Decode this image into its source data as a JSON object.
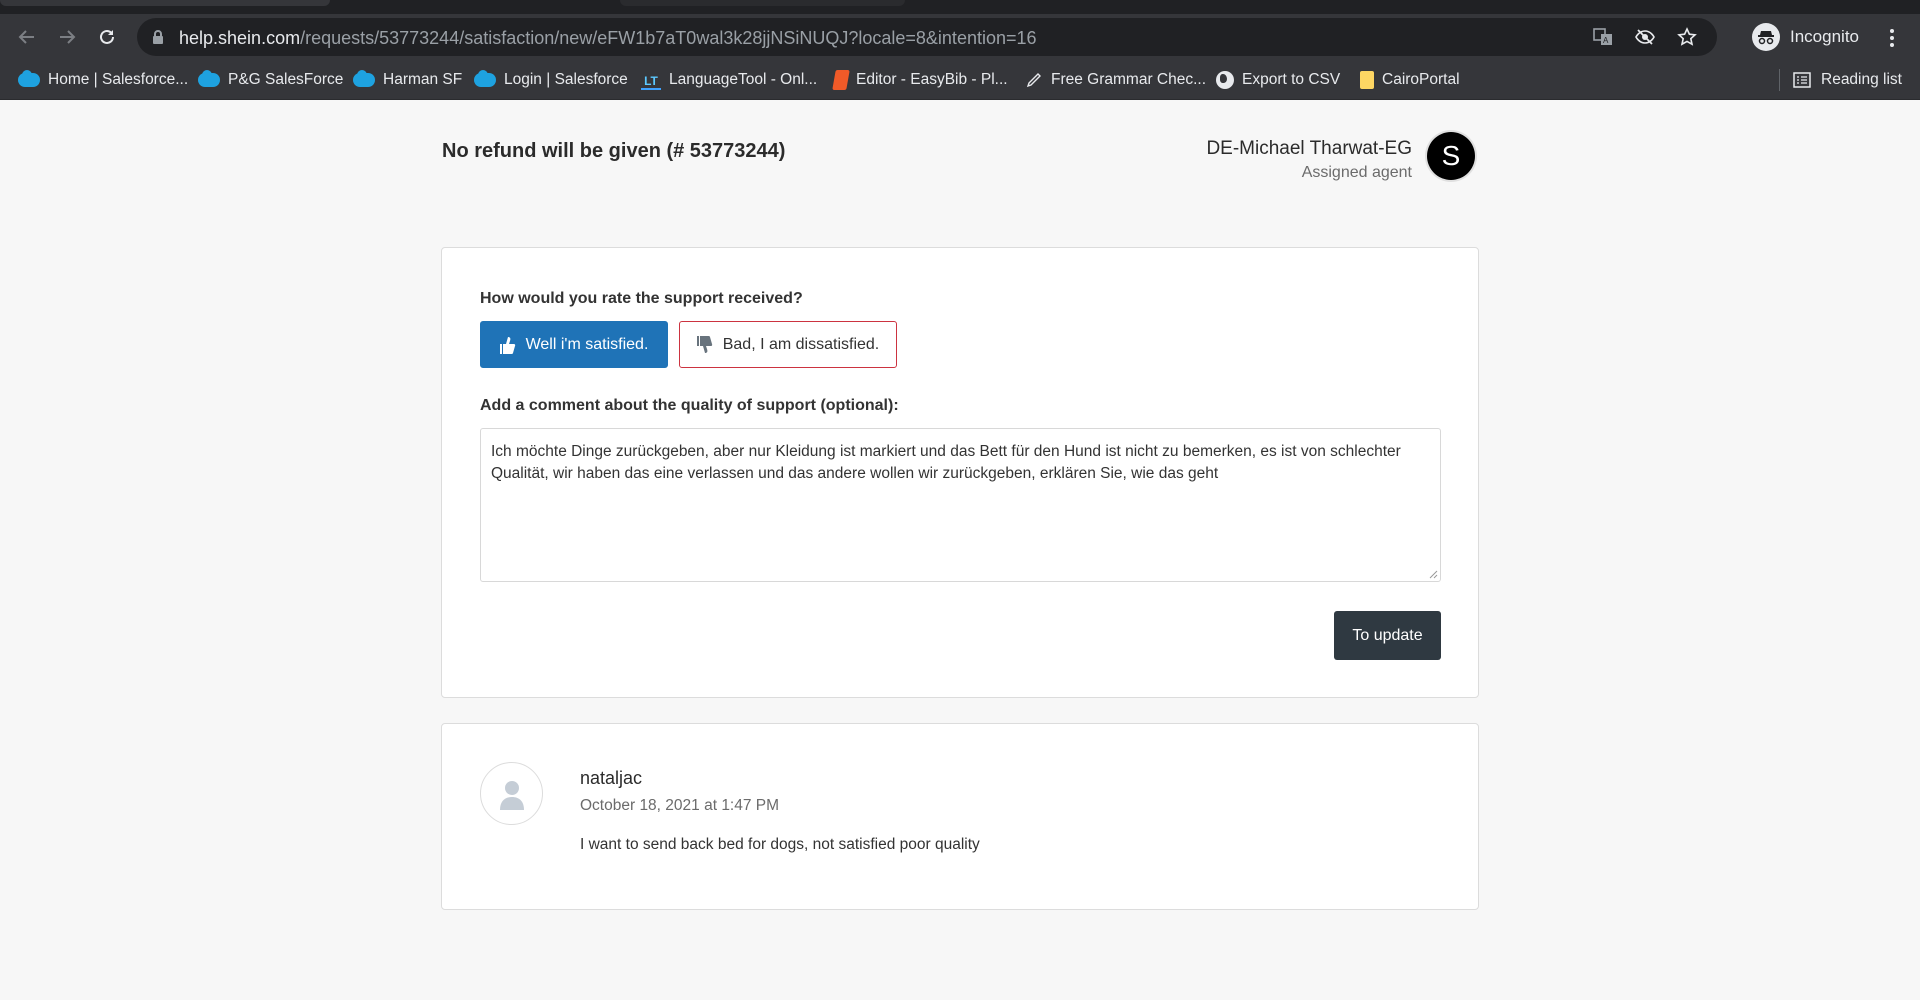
{
  "browser": {
    "url_host": "help.shein.com",
    "url_path": "/requests/53773244/satisfaction/new/eFW1b7aT0wal3k28jjNSiNUQJ?locale=8&intention=16",
    "profile_label": "Incognito",
    "icons": [
      "back-icon",
      "forward-icon",
      "reload-icon",
      "lock-icon",
      "translate-icon",
      "eye-off-icon",
      "star-icon",
      "incognito-icon",
      "menu-icon"
    ]
  },
  "bookmarks": [
    {
      "label": "Home | Salesforce...",
      "icon": "salesforce-icon"
    },
    {
      "label": "P&G SalesForce",
      "icon": "salesforce-icon"
    },
    {
      "label": "Harman SF",
      "icon": "salesforce-icon"
    },
    {
      "label": "Login | Salesforce",
      "icon": "salesforce-icon"
    },
    {
      "label": "LanguageTool - Onl...",
      "icon": "languagetool-icon"
    },
    {
      "label": "Editor - EasyBib - Pl...",
      "icon": "easybib-icon"
    },
    {
      "label": "Free Grammar Chec...",
      "icon": "pen-icon"
    },
    {
      "label": "Export to CSV",
      "icon": "globe-icon"
    },
    {
      "label": "CairoPortal",
      "icon": "folder-icon"
    }
  ],
  "reading_list": "Reading list",
  "request": {
    "title": "No refund will be given (# 53773244)",
    "agent_name": "DE-Michael Tharwat-EG",
    "agent_role": "Assigned agent",
    "agent_initial": "S"
  },
  "rating": {
    "question": "How would you rate the support received?",
    "good_label": "Well i'm satisfied.",
    "bad_label": "Bad, I am dissatisfied.",
    "selected": "good",
    "comment_label": "Add a comment about the quality of support (optional):",
    "comment_value": "Ich möchte Dinge zurückgeben, aber nur Kleidung ist markiert und das Bett für den Hund ist nicht zu bemerken, es ist von schlechter Qualität, wir haben das eine verlassen und das andere wollen wir zurückgeben, erklären Sie, wie das geht",
    "submit_label": "To update"
  },
  "comment": {
    "author": "nataljac",
    "date": "October 18, 2021 at 1:47 PM",
    "text": "I want to send back bed for dogs, not satisfied poor quality"
  },
  "colors": {
    "primary": "#1f73b7",
    "danger_border": "#cc3340",
    "dark_button": "#2f3941",
    "chrome_bg": "#35363a"
  }
}
